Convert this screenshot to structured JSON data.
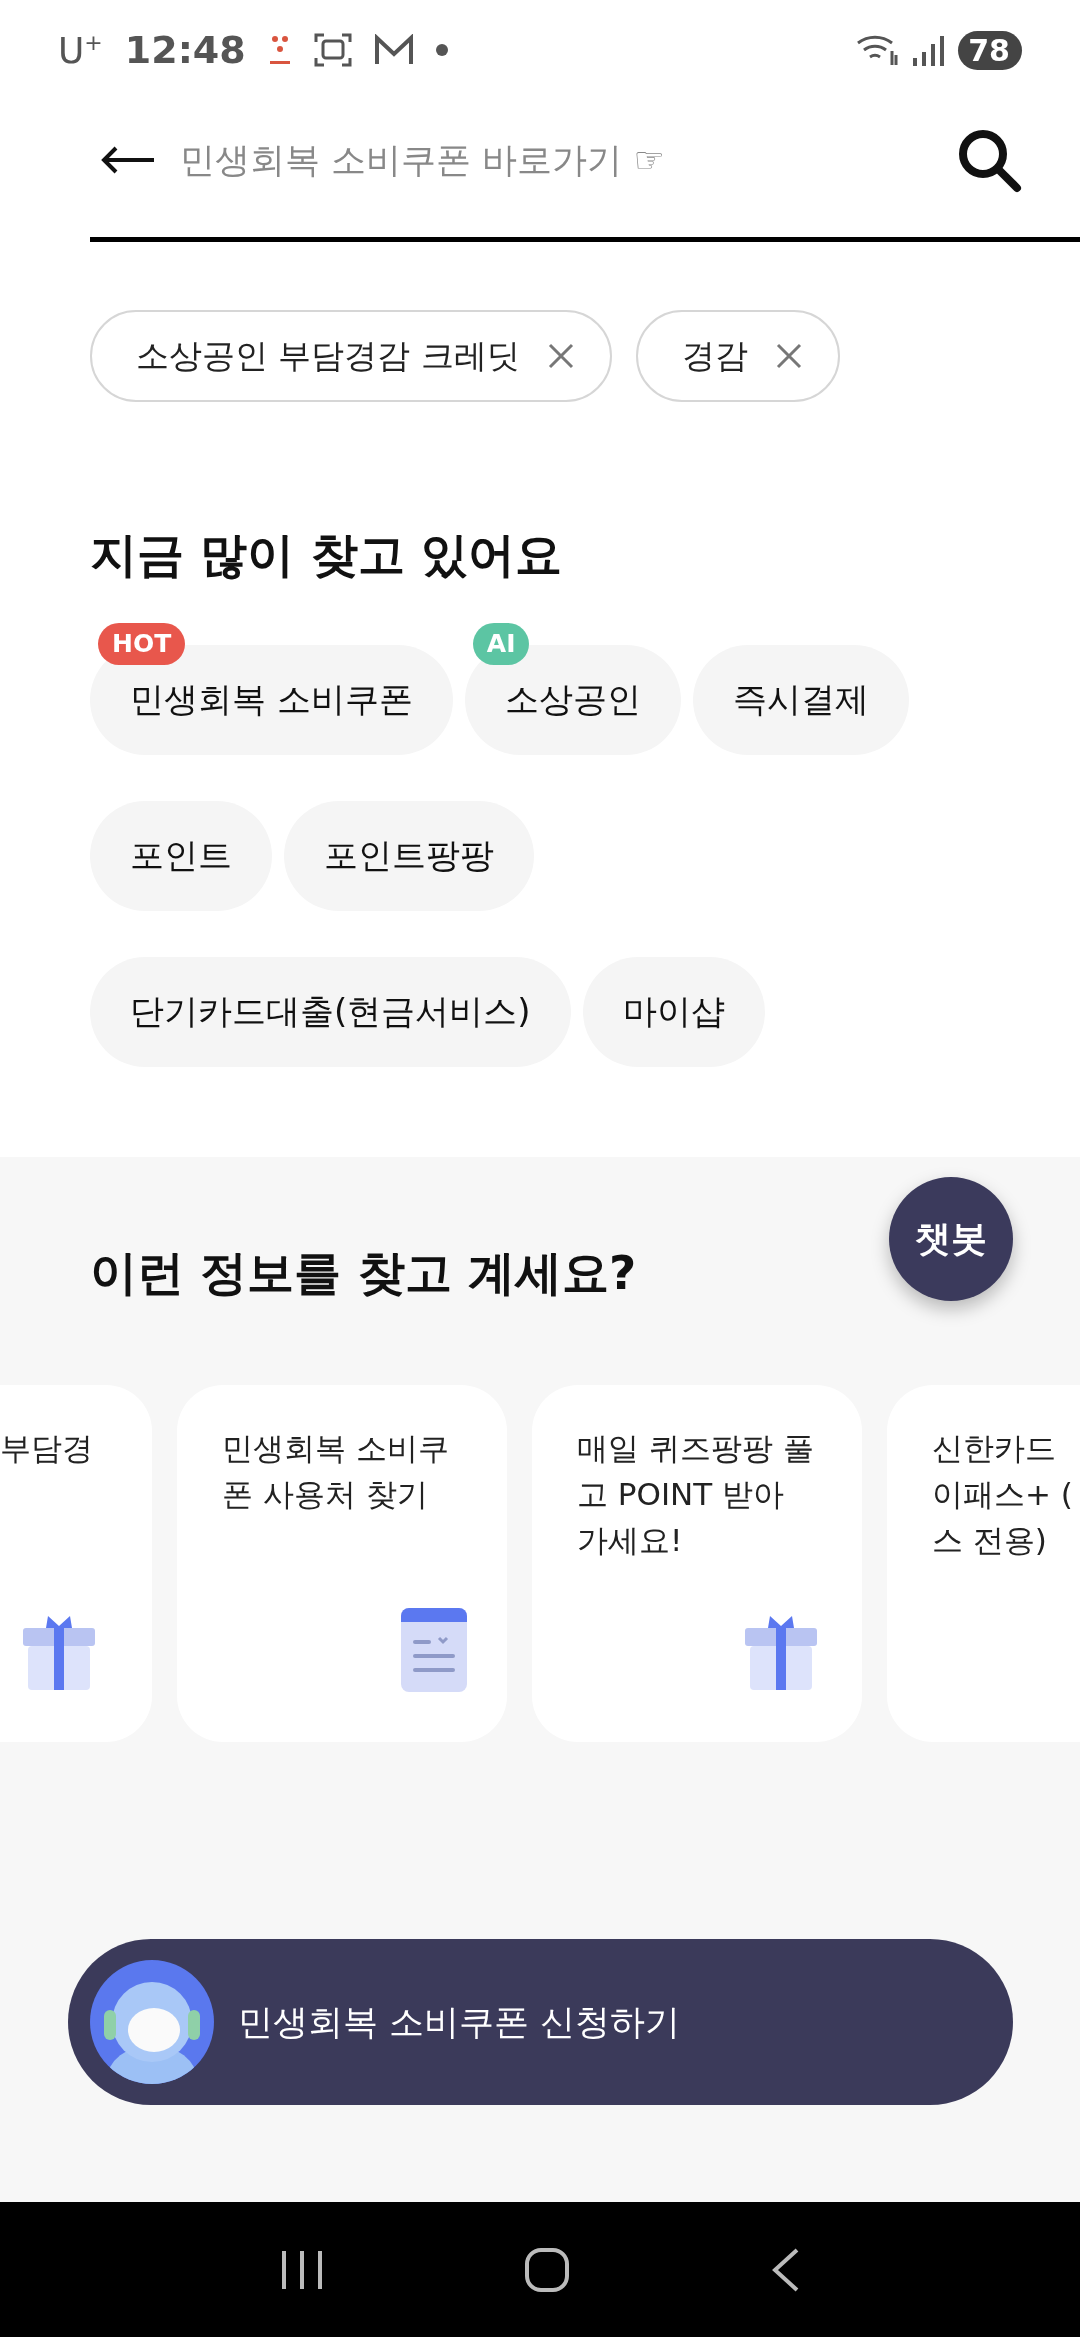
{
  "status_bar": {
    "carrier": "U$^{+}$",
    "time": "12:48",
    "battery": "78"
  },
  "search": {
    "placeholder": "민생회복 소비쿠폰 바로가기 ☞"
  },
  "recent_searches": [
    {
      "label": "소상공인 부담경감 크레딧"
    },
    {
      "label": "경감"
    }
  ],
  "popular": {
    "title": "지금 많이 찾고 있어요",
    "rows": [
      [
        {
          "label": "민생회복 소비쿠폰",
          "badge": "HOT",
          "kind": "hot"
        },
        {
          "label": "소상공인",
          "badge": "AI",
          "kind": "ai"
        },
        {
          "label": "즉시결제"
        }
      ],
      [
        {
          "label": "포인트"
        },
        {
          "label": "포인트팡팡"
        }
      ],
      [
        {
          "label": "단기카드대출(현금서비스)"
        },
        {
          "label": "마이샵"
        }
      ]
    ]
  },
  "suggestions": {
    "title": "이런 정보를 찾고 계세요?",
    "chatbot": "챗봇",
    "cards": [
      {
        "lines": [
          "부담경"
        ],
        "kind": "gift"
      },
      {
        "lines": [
          "민생회복 소비쿠",
          "폰 사용처 찾기"
        ],
        "kind": "document"
      },
      {
        "lines": [
          "매일 퀴즈팡팡 풀",
          "고 POINT 받아",
          "가세요!"
        ],
        "kind": "gift"
      },
      {
        "lines": [
          "신한카드",
          "이패스+ (",
          "스 전용)"
        ]
      }
    ]
  },
  "banner": {
    "label": "민생회복 소비쿠폰 신청하기"
  }
}
